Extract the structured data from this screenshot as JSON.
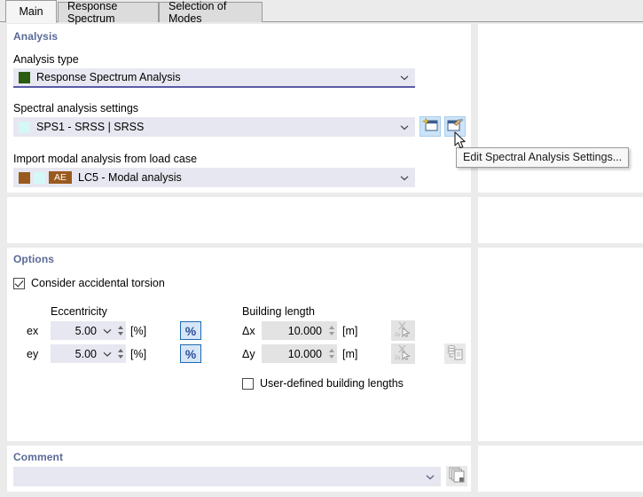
{
  "tabs": [
    {
      "label": "Main",
      "active": true
    },
    {
      "label": "Response Spectrum",
      "active": false
    },
    {
      "label": "Selection of Modes",
      "active": false
    }
  ],
  "analysis": {
    "group_label": "Analysis",
    "analysis_type_label": "Analysis type",
    "analysis_type_value": "Response Spectrum Analysis",
    "analysis_type_swatch": "#2c5c10",
    "spectral_settings_label": "Spectral analysis settings",
    "spectral_settings_value": "SPS1 - SRSS | SRSS",
    "spectral_settings_swatch": "#d4f7f7",
    "new_button_name": "new-spectral-analysis-settings",
    "edit_button_name": "edit-spectral-analysis-settings",
    "import_modal_label": "Import modal analysis from load case",
    "import_modal_value": "LC5 - Modal analysis",
    "import_modal_swatch1": "#9a5a1e",
    "import_modal_swatch2": "#d4f7f7",
    "import_modal_badge": "AE",
    "import_modal_badge_color": "#9a5a1e"
  },
  "tooltip": {
    "text": "Edit Spectral Analysis Settings..."
  },
  "options": {
    "group_label": "Options",
    "accidental_torsion_label": "Consider accidental torsion",
    "accidental_torsion_checked": true,
    "eccentricity_label": "Eccentricity",
    "building_length_label": "Building length",
    "rows": [
      {
        "ecc_name": "ex",
        "ecc_value": "5.00",
        "ecc_unit": "[%]",
        "pct_label": "%",
        "len_name": "Δx",
        "len_value": "10.000",
        "len_unit": "[m]"
      },
      {
        "ecc_name": "ey",
        "ecc_value": "5.00",
        "ecc_unit": "[%]",
        "pct_label": "%",
        "len_name": "Δy",
        "len_value": "10.000",
        "len_unit": "[m]"
      }
    ],
    "user_defined_label": "User-defined building lengths",
    "user_defined_checked": false
  },
  "comment": {
    "group_label": "Comment",
    "value": "",
    "placeholder": ""
  },
  "colors": {
    "group_heading": "#5a6a96",
    "field_bg": "#e7e7f1",
    "field_bg_grey": "#e3e3e3",
    "focus_underline": "#5b5ba8",
    "accent_button_border": "#1f69b0",
    "window_bg": "#ebebeb",
    "panel_bg": "#ffffff"
  }
}
